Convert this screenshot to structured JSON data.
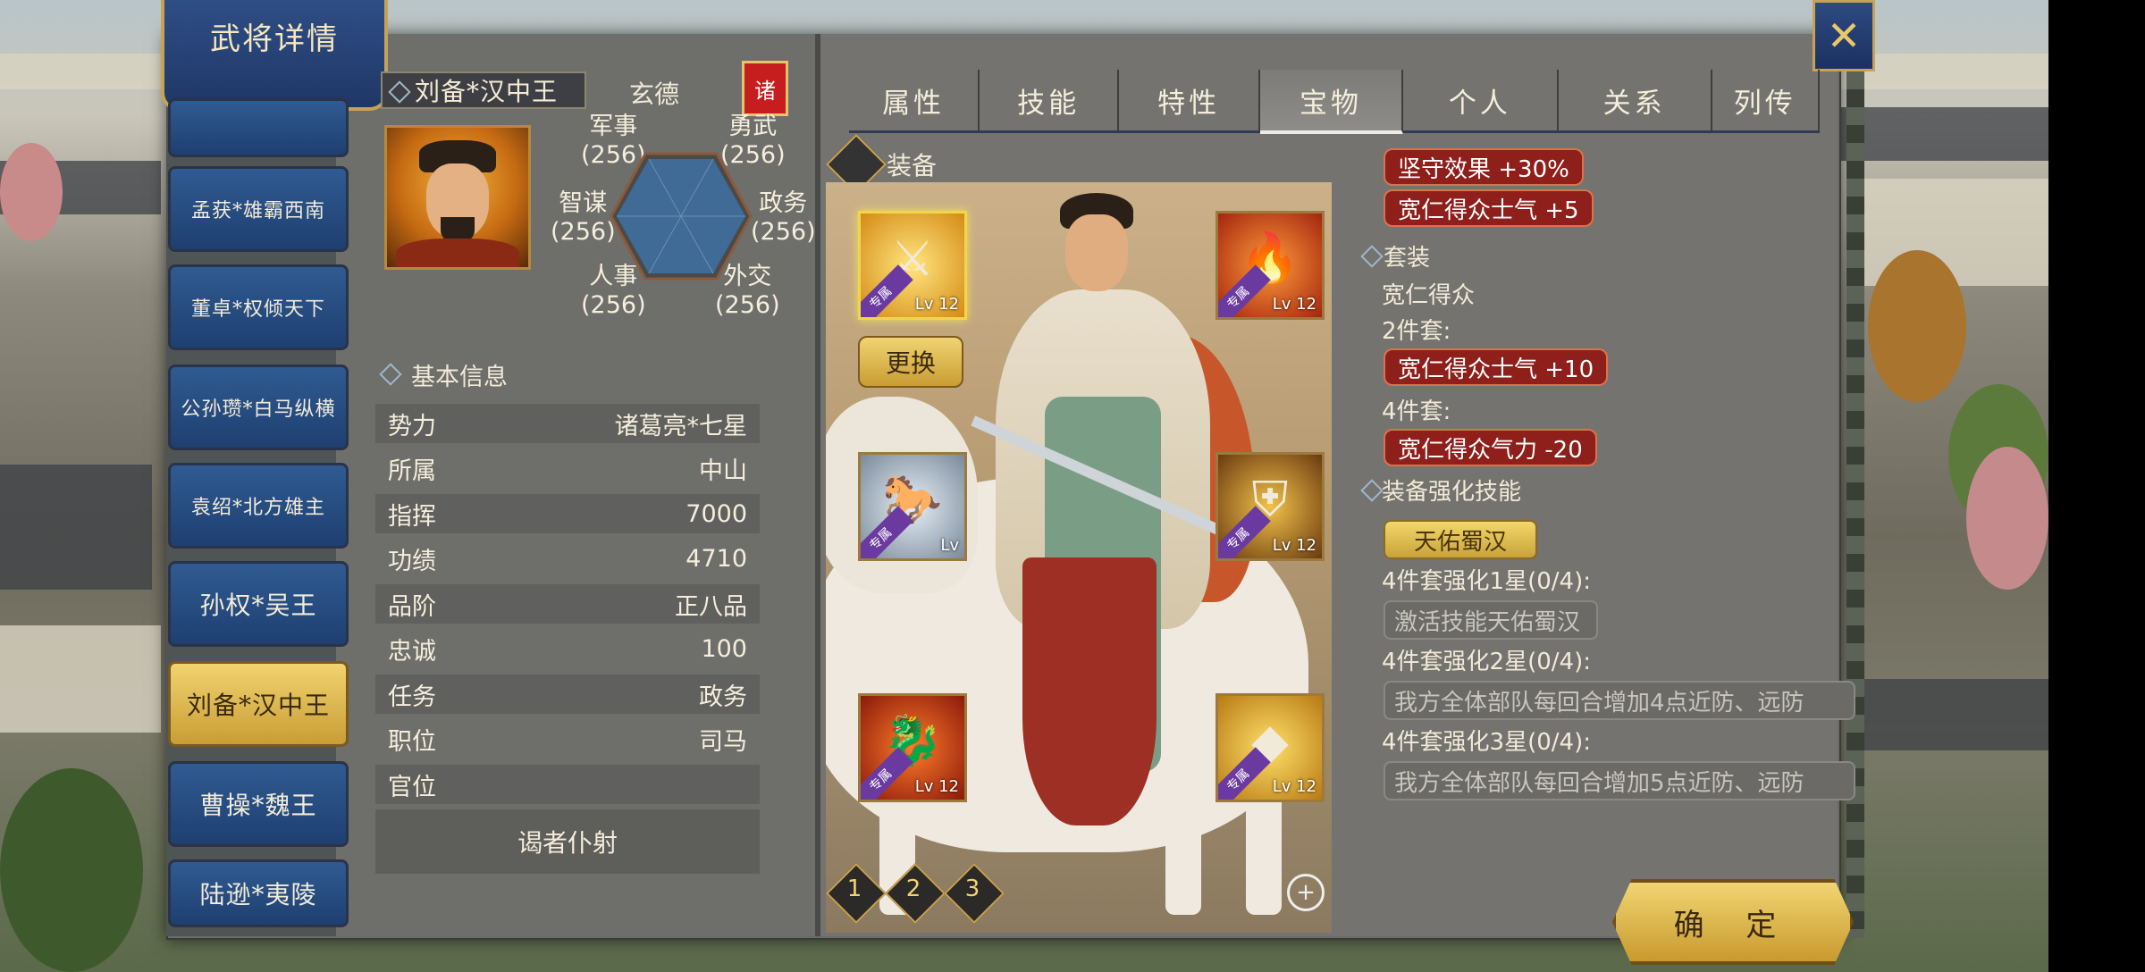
{
  "window": {
    "title": "武将详情",
    "close_icon": "crossed-swords-icon"
  },
  "hero_list": [
    {
      "label": "孟获*雄霸西南",
      "active": false
    },
    {
      "label": "董卓*权倾天下",
      "active": false
    },
    {
      "label": "公孙瓒*白马纵横",
      "active": false
    },
    {
      "label": "袁绍*北方雄主",
      "active": false
    },
    {
      "label": "孙权*吴王",
      "active": false
    },
    {
      "label": "刘备*汉中王",
      "active": true
    },
    {
      "label": "曹操*魏王",
      "active": false
    },
    {
      "label": "陆逊*夷陵",
      "active": false
    }
  ],
  "hero": {
    "name": "刘备*汉中王",
    "style_name": "玄德",
    "faction_badge": "诸",
    "stats": {
      "military": {
        "label": "军事",
        "value": "(256)"
      },
      "valor": {
        "label": "勇武",
        "value": "(256)"
      },
      "intellect": {
        "label": "智谋",
        "value": "(256)"
      },
      "politics": {
        "label": "政务",
        "value": "(256)"
      },
      "personnel": {
        "label": "人事",
        "value": "(256)"
      },
      "diplomacy": {
        "label": "外交",
        "value": "(256)"
      }
    }
  },
  "basic_info": {
    "title": "基本信息",
    "rows": [
      {
        "label": "势力",
        "value": "诸葛亮*七星"
      },
      {
        "label": "所属",
        "value": "中山"
      },
      {
        "label": "指挥",
        "value": "7000"
      },
      {
        "label": "功绩",
        "value": "4710"
      },
      {
        "label": "品阶",
        "value": "正八品"
      },
      {
        "label": "忠诚",
        "value": "100"
      },
      {
        "label": "任务",
        "value": "政务"
      },
      {
        "label": "职位",
        "value": "司马"
      },
      {
        "label": "官位",
        "value": ""
      }
    ],
    "official_title": "谒者仆射"
  },
  "tabs": [
    {
      "label": "属性",
      "active": false
    },
    {
      "label": "技能",
      "active": false
    },
    {
      "label": "特性",
      "active": false
    },
    {
      "label": "宝物",
      "active": true
    },
    {
      "label": "个人",
      "active": false
    },
    {
      "label": "关系",
      "active": false
    },
    {
      "label": "列传",
      "active": false
    }
  ],
  "equipment": {
    "title": "装备",
    "change_button": "更换",
    "slots": [
      {
        "name": "weapon",
        "icon": "crossed-swords-icon",
        "tag": "专属",
        "level": "Lv 12",
        "selected": true
      },
      {
        "name": "armor-crossbow",
        "icon": "flaming-weapon-icon",
        "tag": "专属",
        "level": "Lv 12",
        "selected": false
      },
      {
        "name": "mount",
        "icon": "white-horse-icon",
        "tag": "专属",
        "level": "Lv",
        "selected": false
      },
      {
        "name": "armor",
        "icon": "golden-armor-icon",
        "tag": "专属",
        "level": "Lv 12",
        "selected": false
      },
      {
        "name": "dragon",
        "icon": "dragon-icon",
        "tag": "专属",
        "level": "Lv 12",
        "selected": false
      },
      {
        "name": "treasure",
        "icon": "jade-treasure-icon",
        "tag": "专属",
        "level": "Lv 12",
        "selected": false
      }
    ],
    "pages": [
      "1",
      "2",
      "3"
    ],
    "zoom_icon": "zoom-in-icon"
  },
  "effects": {
    "bonuses": [
      "坚守效果 +30%",
      "宽仁得众士气 +5"
    ],
    "set_title": "套装",
    "set_name": "宽仁得众",
    "set2_label": "2件套:",
    "set2_bonus": "宽仁得众士气 +10",
    "set4_label": "4件套:",
    "set4_bonus": "宽仁得众气力 -20",
    "enhance_title": "装备强化技能",
    "skill_name": "天佑蜀汉",
    "star1_label": "4件套强化1星(0/4):",
    "star1_desc": "激活技能天佑蜀汉",
    "star2_label": "4件套强化2星(0/4):",
    "star2_desc": "我方全体部队每回合增加4点近防、远防",
    "star3_label": "4件套强化3星(0/4):",
    "star3_desc": "我方全体部队每回合增加5点近防、远防"
  },
  "confirm_button": "确 定",
  "colors": {
    "panel": "#6e6e6b",
    "accent_gold": "#c99c33",
    "tab_blue": "#2f5b92",
    "effect_red": "#8e1f1a"
  }
}
